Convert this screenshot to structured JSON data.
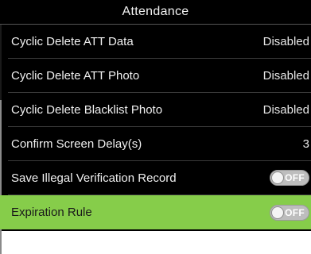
{
  "header": {
    "title": "Attendance"
  },
  "settings": {
    "items": [
      {
        "label": "Cyclic Delete ATT Data",
        "value": "Disabled"
      },
      {
        "label": "Cyclic Delete ATT Photo",
        "value": "Disabled"
      },
      {
        "label": "Cyclic Delete Blacklist Photo",
        "value": "Disabled"
      },
      {
        "label": "Confirm Screen Delay(s)",
        "value": "3"
      },
      {
        "label": "Save Illegal Verification Record",
        "toggle": "OFF"
      },
      {
        "label": "Expiration Rule",
        "toggle": "OFF"
      }
    ]
  },
  "colors": {
    "background": "#000000",
    "selected_row": "#86cd4a",
    "toggle_off": "#bdbdbd"
  }
}
